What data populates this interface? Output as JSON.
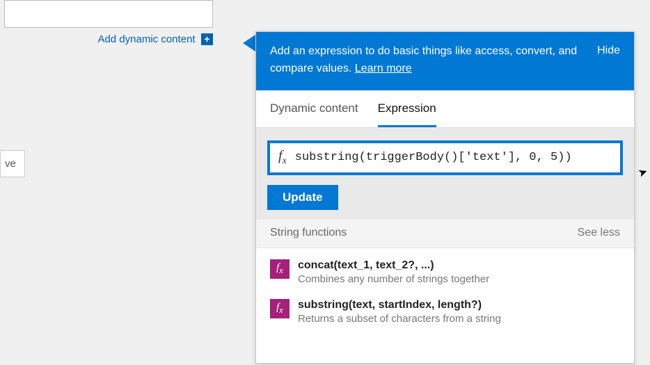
{
  "left": {
    "add_dynamic_label": "Add dynamic content",
    "save_fragment": "ve"
  },
  "panel": {
    "header_text": "Add an expression to do basic things like access, convert, and compare values. ",
    "learn_more": "Learn more",
    "hide": "Hide",
    "tabs": [
      {
        "label": "Dynamic content",
        "active": false
      },
      {
        "label": "Expression",
        "active": true
      }
    ],
    "fx_symbol": "f",
    "fx_sub": "x",
    "expression_value": "substring(triggerBody()['text'], 0, 5))",
    "update_label": "Update",
    "section_title": "String functions",
    "section_toggle": "See less",
    "functions": [
      {
        "sig": "concat(text_1, text_2?, ...)",
        "desc": "Combines any number of strings together"
      },
      {
        "sig": "substring(text, startIndex, length?)",
        "desc": "Returns a subset of characters from a string"
      }
    ]
  },
  "colors": {
    "primary": "#0078d4",
    "fx_badge": "#a4207b"
  }
}
